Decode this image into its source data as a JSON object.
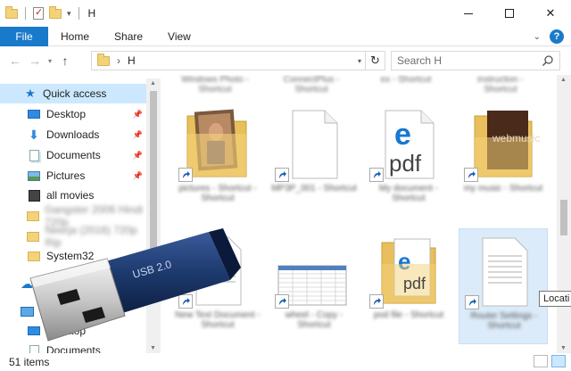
{
  "window": {
    "title": "H",
    "tabs": [
      "File",
      "Home",
      "Share",
      "View"
    ],
    "help_label": "?"
  },
  "address": {
    "crumb": "H",
    "search_placeholder": "Search H"
  },
  "nav": {
    "items": [
      {
        "label": "Quick access",
        "icon": "star-icon",
        "selected": true
      },
      {
        "label": "Desktop",
        "icon": "desktop-icon",
        "pinned": true
      },
      {
        "label": "Downloads",
        "icon": "download-icon",
        "pinned": true
      },
      {
        "label": "Documents",
        "icon": "documents-icon",
        "pinned": true
      },
      {
        "label": "Pictures",
        "icon": "pictures-icon",
        "pinned": true
      },
      {
        "label": "all movies",
        "icon": "movies-icon"
      },
      {
        "label": "Gangster 2006 Hindi 720p",
        "icon": "folder-icon",
        "blurred": true
      },
      {
        "label": "Neerja (2016) 720p Rip",
        "icon": "folder-icon",
        "blurred": true
      },
      {
        "label": "System32",
        "icon": "folder-icon"
      },
      {
        "label": "OneDrive",
        "icon": "cloud-icon"
      },
      {
        "label": "This PC",
        "icon": "pc-icon"
      },
      {
        "label": "Desktop",
        "icon": "desktop-icon"
      },
      {
        "label": "Documents",
        "icon": "documents-icon"
      }
    ]
  },
  "content": {
    "top_labels": [
      "Windows Photo - Shortcut",
      "ConnectPlus - Shortcut",
      "ex - Shortcut",
      "instruction - Shortcut"
    ],
    "tiles": [
      {
        "label": "pictures - Shortcut - Shortcut",
        "type": "folder-photo"
      },
      {
        "label": "MP3P_001 - Shortcut",
        "type": "blank-file"
      },
      {
        "label": "My document - Shortcut",
        "type": "edge-pdf"
      },
      {
        "label": "my music - Shortcut",
        "type": "folder-music"
      },
      {
        "label": "New Text Document - Shortcut",
        "type": "text-file"
      },
      {
        "label": "wheel - Copy - Shortcut",
        "type": "spreadsheet"
      },
      {
        "label": "pod file - Shortcut",
        "type": "folder-pdf"
      },
      {
        "label": "Router Settings - Shortcut",
        "type": "text-file",
        "selected": true
      }
    ],
    "pdf_text": "pdf",
    "music_text": "webmusic"
  },
  "overlay": {
    "usb_text": "USB 2.0"
  },
  "status": {
    "items_count": "51 items",
    "tooltip": "Locati"
  },
  "colors": {
    "accent": "#1979ca",
    "selection": "#cce8ff",
    "usb_body": "#1d3a6e",
    "folder": "#f4d27a"
  }
}
